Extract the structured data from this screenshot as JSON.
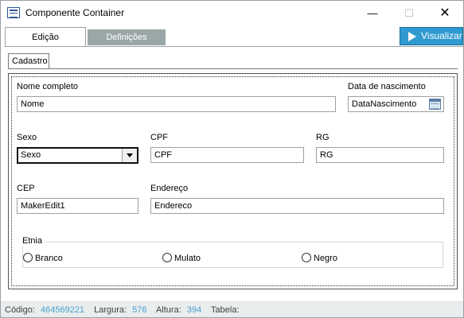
{
  "window": {
    "title": "Componente Container"
  },
  "tabs": {
    "edicao": "Edição",
    "definicoes": "Definições",
    "visualizar": "Visualizar"
  },
  "subtab": {
    "cadastro": "Cadastro"
  },
  "form": {
    "nome_label": "Nome completo",
    "nome_value": "Nome",
    "data_label": "Data de nascimento",
    "data_value": "DataNascimento",
    "sexo_label": "Sexo",
    "sexo_value": "Sexo",
    "cpf_label": "CPF",
    "cpf_value": "CPF",
    "rg_label": "RG",
    "rg_value": "RG",
    "cep_label": "CEP",
    "cep_value": "MakerEdit1",
    "endereco_label": "Endereço",
    "endereco_value": "Endereco",
    "etnia_label": "Etnia",
    "etnia_options": [
      "Branco",
      "Mulato",
      "Negro"
    ]
  },
  "status": {
    "codigo_label": "Código:",
    "codigo_value": "464569221",
    "largura_label": "Largura:",
    "largura_value": "576",
    "altura_label": "Altura:",
    "altura_value": "394",
    "tabela_label": "Tabela:"
  },
  "colors": {
    "accent": "#2f9ad0",
    "inactive_tab": "#9aa7a8",
    "status_value": "#4aa0d0",
    "statusbar_bg": "#e9eded"
  }
}
